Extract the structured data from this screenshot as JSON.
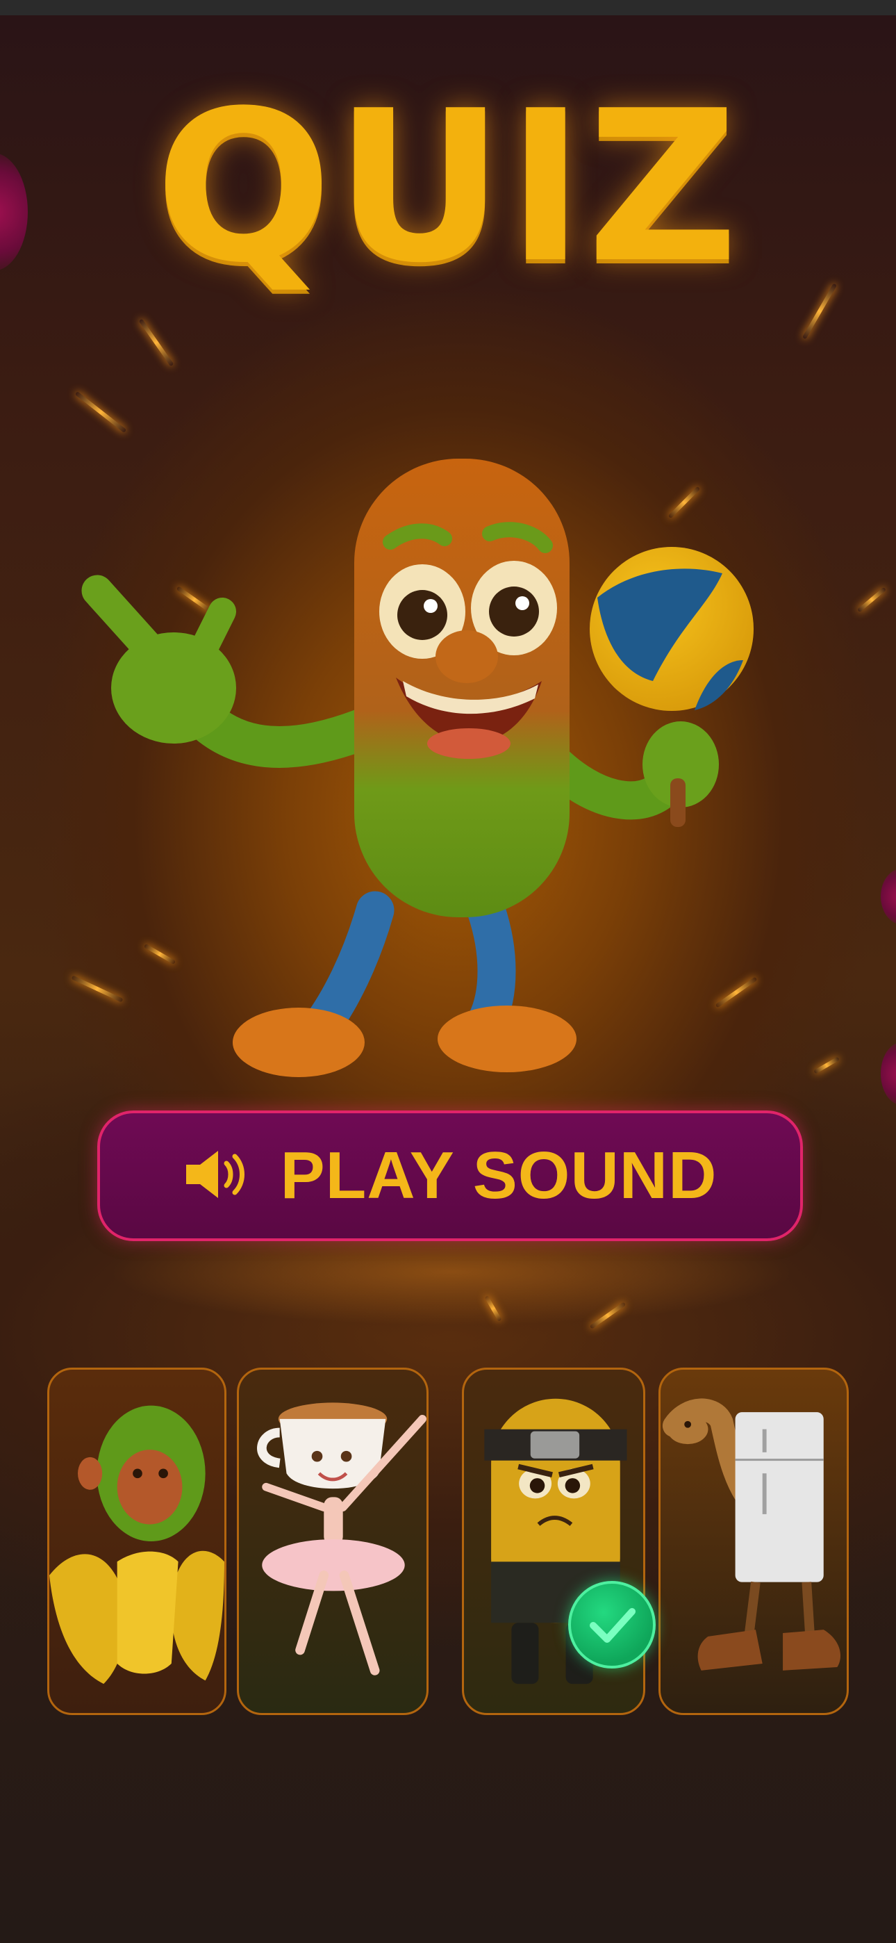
{
  "title": "QUIZ",
  "play_button": {
    "label": "PLAY SOUND",
    "icon": "speaker-icon"
  },
  "mascot": {
    "icon": "pickle-mascot-with-ball"
  },
  "options": [
    {
      "icon": "monkey-banana-icon",
      "selected": false
    },
    {
      "icon": "coffee-ballerina-icon",
      "selected": false
    },
    {
      "icon": "ninja-minion-icon",
      "selected": true
    },
    {
      "icon": "camel-fridge-boots-icon",
      "selected": false
    }
  ],
  "colors": {
    "title": "#f3b10d",
    "button_bg": "#6f0a54",
    "button_border": "#e0246a",
    "button_text": "#f4b719",
    "card_border": "#b3650e",
    "check": "#16b866"
  }
}
